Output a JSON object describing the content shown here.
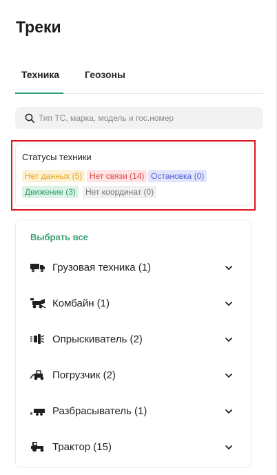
{
  "page": {
    "title": "Треки"
  },
  "tabs": [
    {
      "label": "Техника",
      "active": true
    },
    {
      "label": "Геозоны",
      "active": false
    }
  ],
  "search": {
    "placeholder": "Тип ТС, марка, модель и гос.номер",
    "value": ""
  },
  "statuses": {
    "title": "Статусы техники",
    "badges": [
      {
        "label": "Нет данных (5)",
        "color": "#e3a31a"
      },
      {
        "label": "Нет связи (14)",
        "color": "#e04848"
      },
      {
        "label": "Остановка (0)",
        "color": "#5563d8"
      },
      {
        "label": "Движение (3)",
        "color": "#2f9e6e"
      },
      {
        "label": "Нет координат (0)",
        "color": "#777777"
      }
    ]
  },
  "categories": {
    "select_all": "Выбрать все",
    "items": [
      {
        "label": "Грузовая техника (1)",
        "icon": "truck-icon"
      },
      {
        "label": "Комбайн (1)",
        "icon": "combine-icon"
      },
      {
        "label": "Опрыскиватель (2)",
        "icon": "sprayer-icon"
      },
      {
        "label": "Погрузчик (2)",
        "icon": "loader-icon"
      },
      {
        "label": "Разбрасыватель (1)",
        "icon": "spreader-icon"
      },
      {
        "label": "Трактор (15)",
        "icon": "tractor-icon"
      }
    ]
  },
  "colors": {
    "accent": "#2f9e6e",
    "highlight": "#e0141e"
  }
}
